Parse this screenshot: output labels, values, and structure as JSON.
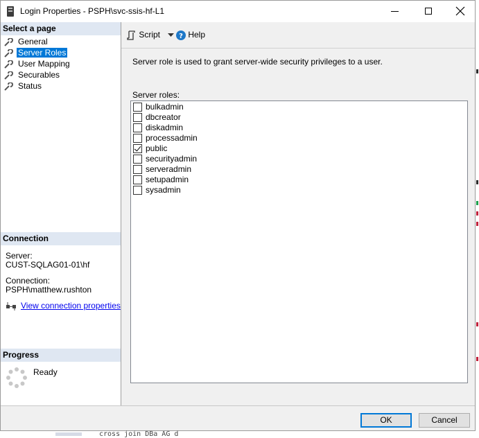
{
  "window": {
    "title": "Login Properties - PSPH\\svc-ssis-hf-L1"
  },
  "left": {
    "select_page_header": "Select a page",
    "pages": [
      {
        "label": "General",
        "selected": false
      },
      {
        "label": "Server Roles",
        "selected": true
      },
      {
        "label": "User Mapping",
        "selected": false
      },
      {
        "label": "Securables",
        "selected": false
      },
      {
        "label": "Status",
        "selected": false
      }
    ],
    "connection_header": "Connection",
    "server_label": "Server:",
    "server_value": "CUST-SQLAG01-01\\hf",
    "connection_label": "Connection:",
    "connection_value": "PSPH\\matthew.rushton",
    "view_conn_link": "View connection properties",
    "progress_header": "Progress",
    "progress_status": "Ready"
  },
  "toolbar": {
    "script_label": "Script",
    "help_label": "Help"
  },
  "main": {
    "description": "Server role is used to grant server-wide security privileges to a user.",
    "roles_label": "Server roles:",
    "roles": [
      {
        "name": "bulkadmin",
        "checked": false
      },
      {
        "name": "dbcreator",
        "checked": false
      },
      {
        "name": "diskadmin",
        "checked": false
      },
      {
        "name": "processadmin",
        "checked": false
      },
      {
        "name": "public",
        "checked": true
      },
      {
        "name": "securityadmin",
        "checked": false
      },
      {
        "name": "serveradmin",
        "checked": false
      },
      {
        "name": "setupadmin",
        "checked": false
      },
      {
        "name": "sysadmin",
        "checked": false
      }
    ]
  },
  "buttons": {
    "ok": "OK",
    "cancel": "Cancel"
  },
  "background": {
    "partial_text": "cross join DBa AG d"
  },
  "colors": {
    "selection": "#0078d7",
    "section_header": "#dfe7f2",
    "link": "#0000ee"
  }
}
